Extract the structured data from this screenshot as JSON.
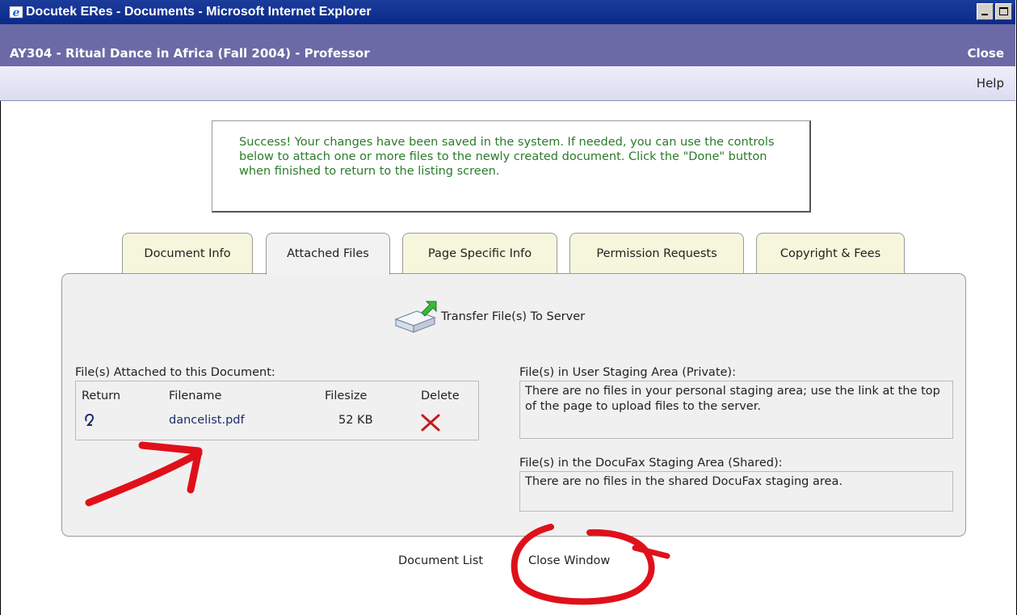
{
  "window": {
    "title": "Docutek ERes - Documents - Microsoft Internet Explorer",
    "icon": "internet-explorer-icon"
  },
  "course": {
    "title": "AY304 - Ritual Dance in Africa (Fall 2004) - Professor",
    "close_label": "Close"
  },
  "help_label": "Help",
  "success_message": "Success! Your changes have been saved in the system. If needed, you can use the controls below to attach one or more files to the newly created document. Click the \"Done\" button when finished to return to the listing screen.",
  "tabs": [
    {
      "label": "Document Info",
      "active": false
    },
    {
      "label": "Attached Files",
      "active": true
    },
    {
      "label": "Page Specific Info",
      "active": false
    },
    {
      "label": "Permission Requests",
      "active": false
    },
    {
      "label": "Copyright & Fees",
      "active": false
    }
  ],
  "transfer": {
    "label": "Transfer File(s) To Server",
    "icon": "upload-drive-icon"
  },
  "attached": {
    "heading": "File(s) Attached to this Document:",
    "columns": {
      "return": "Return",
      "filename": "Filename",
      "filesize": "Filesize",
      "delete": "Delete"
    },
    "rows": [
      {
        "filename": "dancelist.pdf",
        "filesize": "52 KB",
        "return_icon": "return-arrow-icon",
        "delete_icon": "delete-x-icon"
      }
    ]
  },
  "user_staging": {
    "heading": "File(s) in User Staging Area (Private):",
    "message": "There are no files in your personal staging area; use the link at the top of the page to upload files to the server."
  },
  "docufax_staging": {
    "heading": "File(s) in the DocuFax Staging Area (Shared):",
    "message": "There are no files in the shared DocuFax staging area."
  },
  "bottom_links": {
    "document_list": "Document List",
    "separator": "|",
    "close_window": "Close Window"
  },
  "colors": {
    "title_bar": "#0a2a8a",
    "course_bar": "#6b6aa6",
    "success_text": "#2a7a2a",
    "annotation": "#e0101a",
    "delete_x": "#c41c1c"
  }
}
